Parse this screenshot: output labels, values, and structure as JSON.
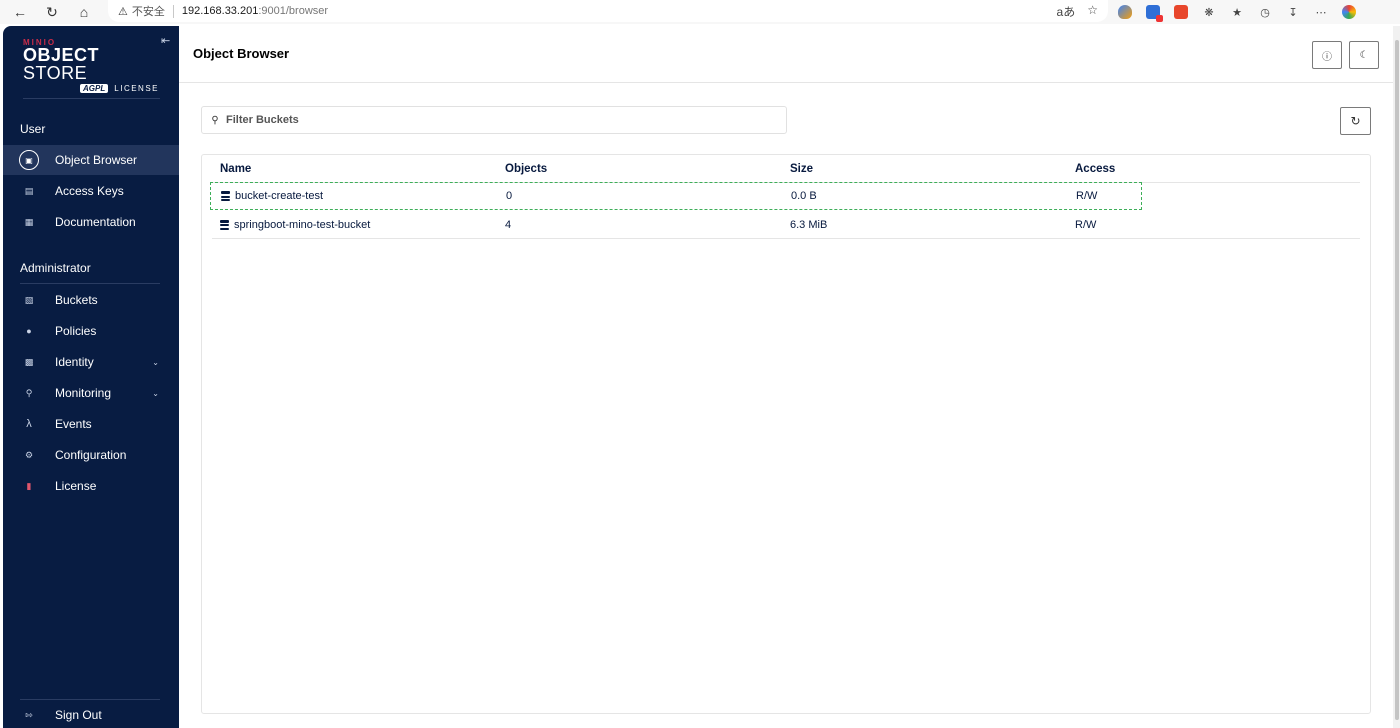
{
  "browser": {
    "insecure_label": "不安全",
    "url_host": "192.168.33.201",
    "url_path": ":9001/browser"
  },
  "sidebar": {
    "logo": {
      "brand_top": "MINIO",
      "product_bold": "OBJECT",
      "product_light": " STORE",
      "agpl": "AGPL",
      "license": "LICENSE"
    },
    "user_section": "User",
    "user_items": [
      {
        "label": "Object Browser",
        "icon": "object-browser-icon"
      },
      {
        "label": "Access Keys",
        "icon": "access-keys-icon"
      },
      {
        "label": "Documentation",
        "icon": "documentation-icon"
      }
    ],
    "admin_section": "Administrator",
    "admin_items": [
      {
        "label": "Buckets",
        "icon": "buckets-icon"
      },
      {
        "label": "Policies",
        "icon": "policies-icon"
      },
      {
        "label": "Identity",
        "icon": "identity-icon"
      },
      {
        "label": "Monitoring",
        "icon": "monitoring-icon"
      },
      {
        "label": "Events",
        "icon": "lambda-icon"
      },
      {
        "label": "Configuration",
        "icon": "gear-icon"
      },
      {
        "label": "License",
        "icon": "license-icon"
      }
    ],
    "sign_out": "Sign Out"
  },
  "main": {
    "title": "Object Browser",
    "filter_placeholder": "Filter Buckets",
    "table": {
      "headers": {
        "name": "Name",
        "objects": "Objects",
        "size": "Size",
        "access": "Access"
      },
      "rows": [
        {
          "name": "bucket-create-test",
          "objects": "0",
          "size": "0.0 B",
          "access": "R/W"
        },
        {
          "name": "springboot-mino-test-bucket",
          "objects": "4",
          "size": "6.3 MiB",
          "access": "R/W"
        }
      ]
    }
  },
  "colors": {
    "sidebar_bg": "#081c42",
    "active_item": "#22355c",
    "selection_dash": "#3dae58",
    "brand_red": "#c72c48"
  }
}
